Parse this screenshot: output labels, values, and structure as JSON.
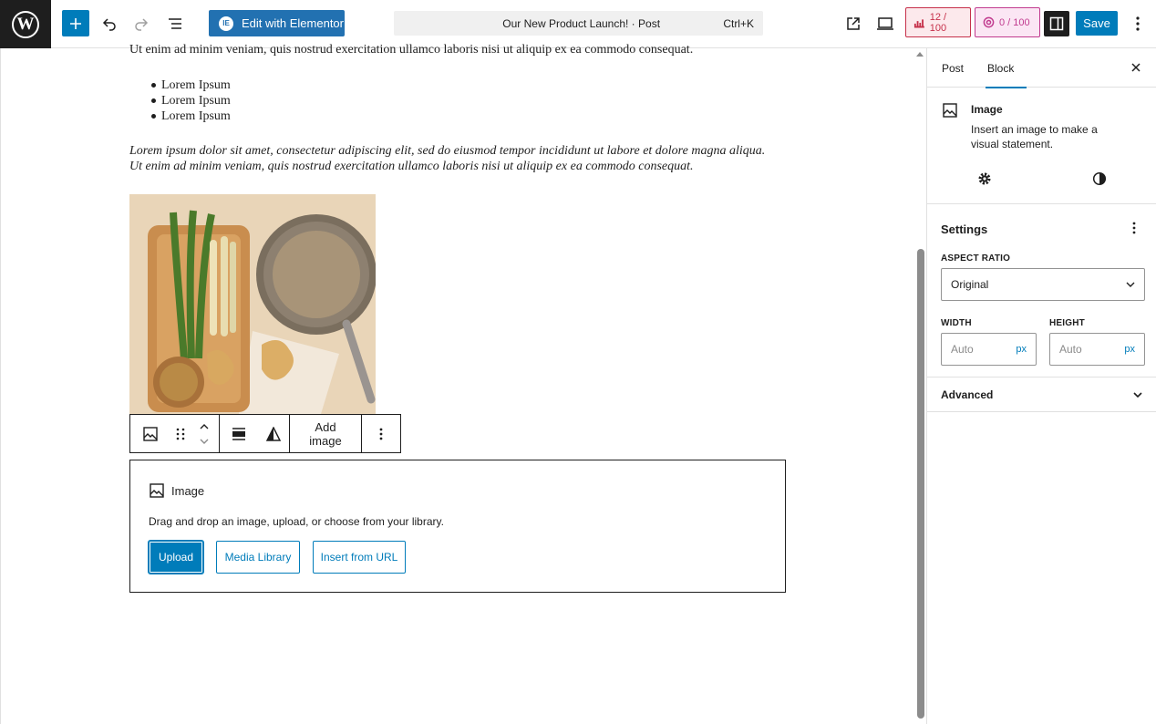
{
  "header": {
    "elementor_label": "Edit with Elementor",
    "command_title": "Our New Product Launch! · Post",
    "command_shortcut": "Ctrl+K",
    "score_a": "12 / 100",
    "score_b": "0 / 100",
    "save_label": "Save",
    "colors": {
      "accent": "#007cba",
      "score_a": "#c6304a",
      "score_b": "#c13b8f"
    }
  },
  "content": {
    "top_para": "Ut enim ad minim veniam, quis nostrud exercitation ullamco laboris nisi ut aliquip ex ea commodo consequat.",
    "list": [
      "Lorem Ipsum",
      "Lorem Ipsum",
      "Lorem Ipsum"
    ],
    "italic_line1": "Lorem ipsum dolor sit amet, consectetur adipiscing elit, sed do eiusmod tempor incididunt ut labore et dolore magna aliqua.",
    "italic_line2": "Ut enim ad minim veniam, quis nostrud exercitation ullamco laboris nisi ut aliquip ex ea commodo consequat."
  },
  "block_toolbar": {
    "add_image_label": "Add image"
  },
  "placeholder": {
    "title": "Image",
    "instructions": "Drag and drop an image, upload, or choose from your library.",
    "upload_label": "Upload",
    "media_label": "Media Library",
    "url_label": "Insert from URL"
  },
  "sidebar": {
    "tab_post": "Post",
    "tab_block": "Block",
    "block_title": "Image",
    "block_desc": "Insert an image to make a visual statement.",
    "settings_title": "Settings",
    "aspect_label": "ASPECT RATIO",
    "aspect_value": "Original",
    "width_label": "WIDTH",
    "height_label": "HEIGHT",
    "width_placeholder": "Auto",
    "height_placeholder": "Auto",
    "unit": "px",
    "advanced_label": "Advanced"
  }
}
